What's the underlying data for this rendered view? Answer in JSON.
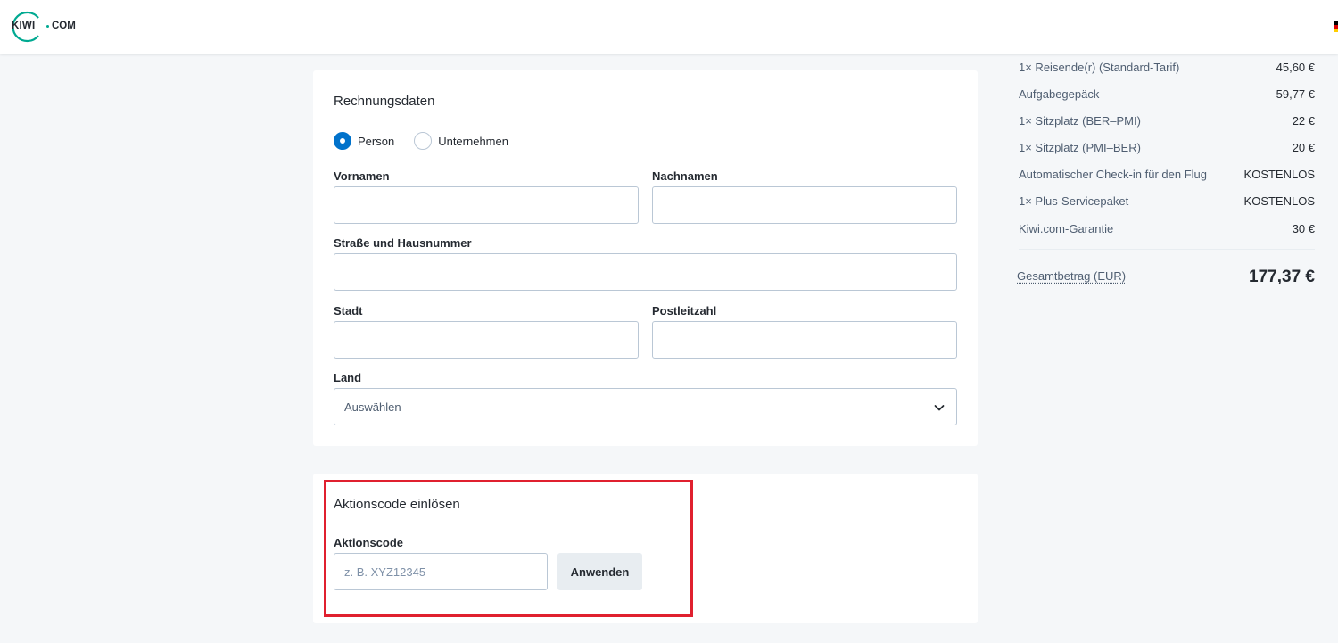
{
  "header": {
    "logo_kiwi": "KIWI",
    "logo_com": "COM",
    "brand_color": "#00a991"
  },
  "billing": {
    "title": "Rechnungsdaten",
    "type_options": [
      {
        "label": "Person",
        "selected": true
      },
      {
        "label": "Unternehmen",
        "selected": false
      }
    ],
    "first_name_label": "Vornamen",
    "first_name_value": "",
    "last_name_label": "Nachnamen",
    "last_name_value": "",
    "street_label": "Straße und Hausnummer",
    "street_value": "",
    "city_label": "Stadt",
    "city_value": "",
    "zip_label": "Postleitzahl",
    "zip_value": "",
    "country_label": "Land",
    "country_value": "Auswählen"
  },
  "promo": {
    "title": "Aktionscode einlösen",
    "code_label": "Aktionscode",
    "code_placeholder": "z. B. XYZ12345",
    "code_value": "",
    "apply_label": "Anwenden",
    "highlight_color": "#e0202f"
  },
  "summary": {
    "items": [
      {
        "label": "1× Reisende(r) (Standard-Tarif)",
        "value": "45,60 €"
      },
      {
        "label": "Aufgabegepäck",
        "value": "59,77 €"
      },
      {
        "label": "1× Sitzplatz (BER–PMI)",
        "value": "22 €"
      },
      {
        "label": "1× Sitzplatz (PMI–BER)",
        "value": "20 €"
      },
      {
        "label": "Automatischer Check-in für den Flug",
        "value": "KOSTENLOS"
      },
      {
        "label": "1× Plus-Servicepaket",
        "value": "KOSTENLOS"
      },
      {
        "label": "Kiwi.com-Garantie",
        "value": "30 €"
      }
    ],
    "total_label": "Gesamtbetrag (EUR)",
    "total_value": "177,37 €"
  }
}
